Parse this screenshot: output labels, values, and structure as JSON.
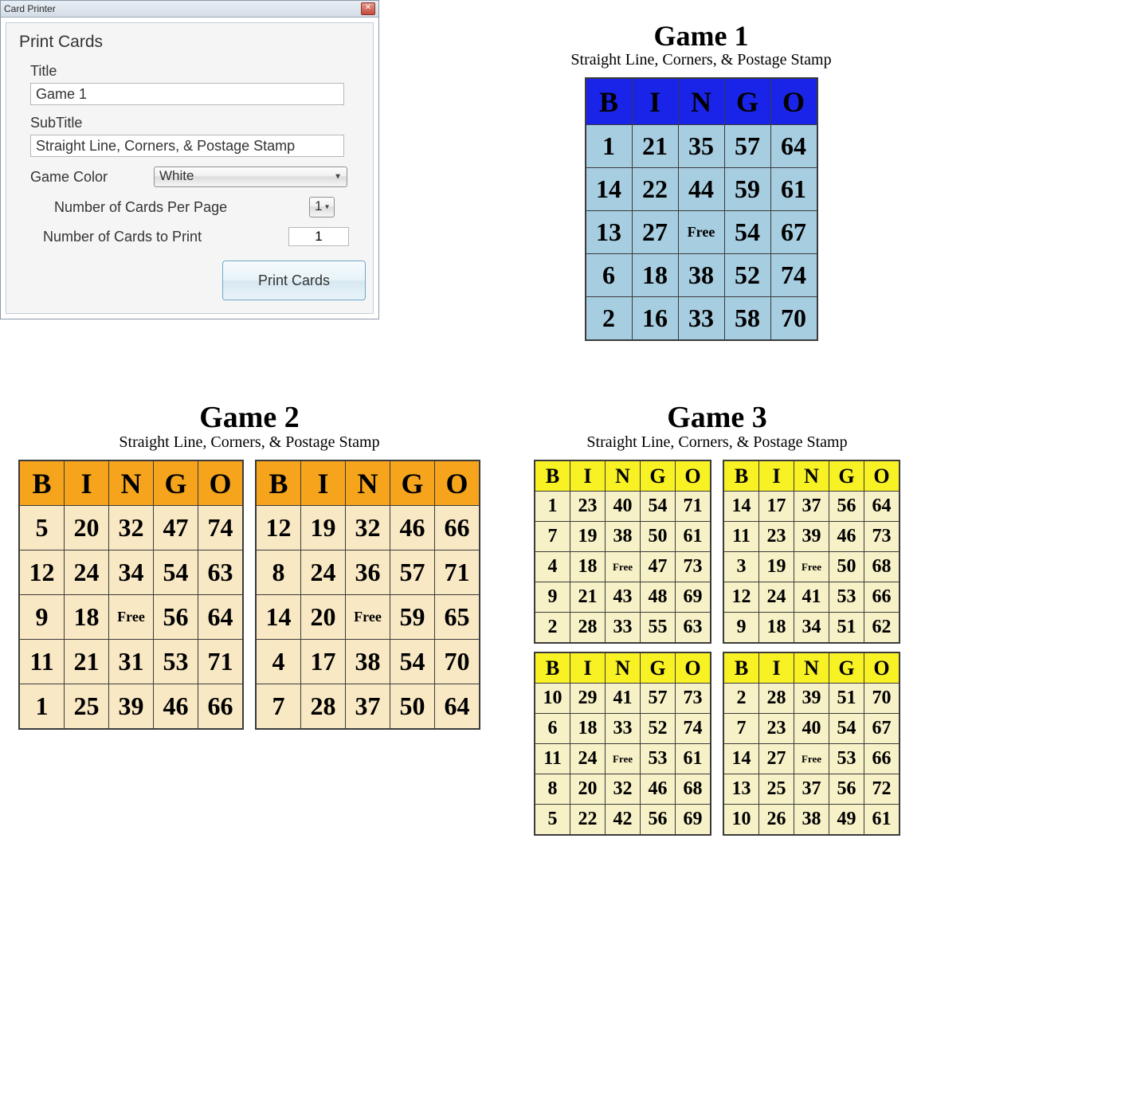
{
  "dialog": {
    "window_title": "Card Printer",
    "section": "Print Cards",
    "title_label": "Title",
    "title_value": "Game 1",
    "subtitle_label": "SubTitle",
    "subtitle_value": "Straight Line, Corners, & Postage Stamp",
    "color_label": "Game Color",
    "color_value": "White",
    "perpage_label": "Number of Cards Per Page",
    "perpage_value": "1",
    "toprint_label": "Number of Cards to Print",
    "toprint_value": "1",
    "button": "Print Cards"
  },
  "letters": [
    "B",
    "I",
    "N",
    "G",
    "O"
  ],
  "game1": {
    "title": "Game 1",
    "subtitle": "Straight Line, Corners, & Postage Stamp",
    "cards": [
      [
        [
          "1",
          "21",
          "35",
          "57",
          "64"
        ],
        [
          "14",
          "22",
          "44",
          "59",
          "61"
        ],
        [
          "13",
          "27",
          "Free",
          "54",
          "67"
        ],
        [
          "6",
          "18",
          "38",
          "52",
          "74"
        ],
        [
          "2",
          "16",
          "33",
          "58",
          "70"
        ]
      ]
    ]
  },
  "game2": {
    "title": "Game 2",
    "subtitle": "Straight Line, Corners, & Postage Stamp",
    "cards": [
      [
        [
          "5",
          "20",
          "32",
          "47",
          "74"
        ],
        [
          "12",
          "24",
          "34",
          "54",
          "63"
        ],
        [
          "9",
          "18",
          "Free",
          "56",
          "64"
        ],
        [
          "11",
          "21",
          "31",
          "53",
          "71"
        ],
        [
          "1",
          "25",
          "39",
          "46",
          "66"
        ]
      ],
      [
        [
          "12",
          "19",
          "32",
          "46",
          "66"
        ],
        [
          "8",
          "24",
          "36",
          "57",
          "71"
        ],
        [
          "14",
          "20",
          "Free",
          "59",
          "65"
        ],
        [
          "4",
          "17",
          "38",
          "54",
          "70"
        ],
        [
          "7",
          "28",
          "37",
          "50",
          "64"
        ]
      ]
    ]
  },
  "game3": {
    "title": "Game 3",
    "subtitle": "Straight Line, Corners, & Postage Stamp",
    "cards": [
      [
        [
          "1",
          "23",
          "40",
          "54",
          "71"
        ],
        [
          "7",
          "19",
          "38",
          "50",
          "61"
        ],
        [
          "4",
          "18",
          "Free",
          "47",
          "73"
        ],
        [
          "9",
          "21",
          "43",
          "48",
          "69"
        ],
        [
          "2",
          "28",
          "33",
          "55",
          "63"
        ]
      ],
      [
        [
          "14",
          "17",
          "37",
          "56",
          "64"
        ],
        [
          "11",
          "23",
          "39",
          "46",
          "73"
        ],
        [
          "3",
          "19",
          "Free",
          "50",
          "68"
        ],
        [
          "12",
          "24",
          "41",
          "53",
          "66"
        ],
        [
          "9",
          "18",
          "34",
          "51",
          "62"
        ]
      ],
      [
        [
          "10",
          "29",
          "41",
          "57",
          "73"
        ],
        [
          "6",
          "18",
          "33",
          "52",
          "74"
        ],
        [
          "11",
          "24",
          "Free",
          "53",
          "61"
        ],
        [
          "8",
          "20",
          "32",
          "46",
          "68"
        ],
        [
          "5",
          "22",
          "42",
          "56",
          "69"
        ]
      ],
      [
        [
          "2",
          "28",
          "39",
          "51",
          "70"
        ],
        [
          "7",
          "23",
          "40",
          "54",
          "67"
        ],
        [
          "14",
          "27",
          "Free",
          "53",
          "66"
        ],
        [
          "13",
          "25",
          "37",
          "56",
          "72"
        ],
        [
          "10",
          "26",
          "38",
          "49",
          "61"
        ]
      ]
    ]
  }
}
